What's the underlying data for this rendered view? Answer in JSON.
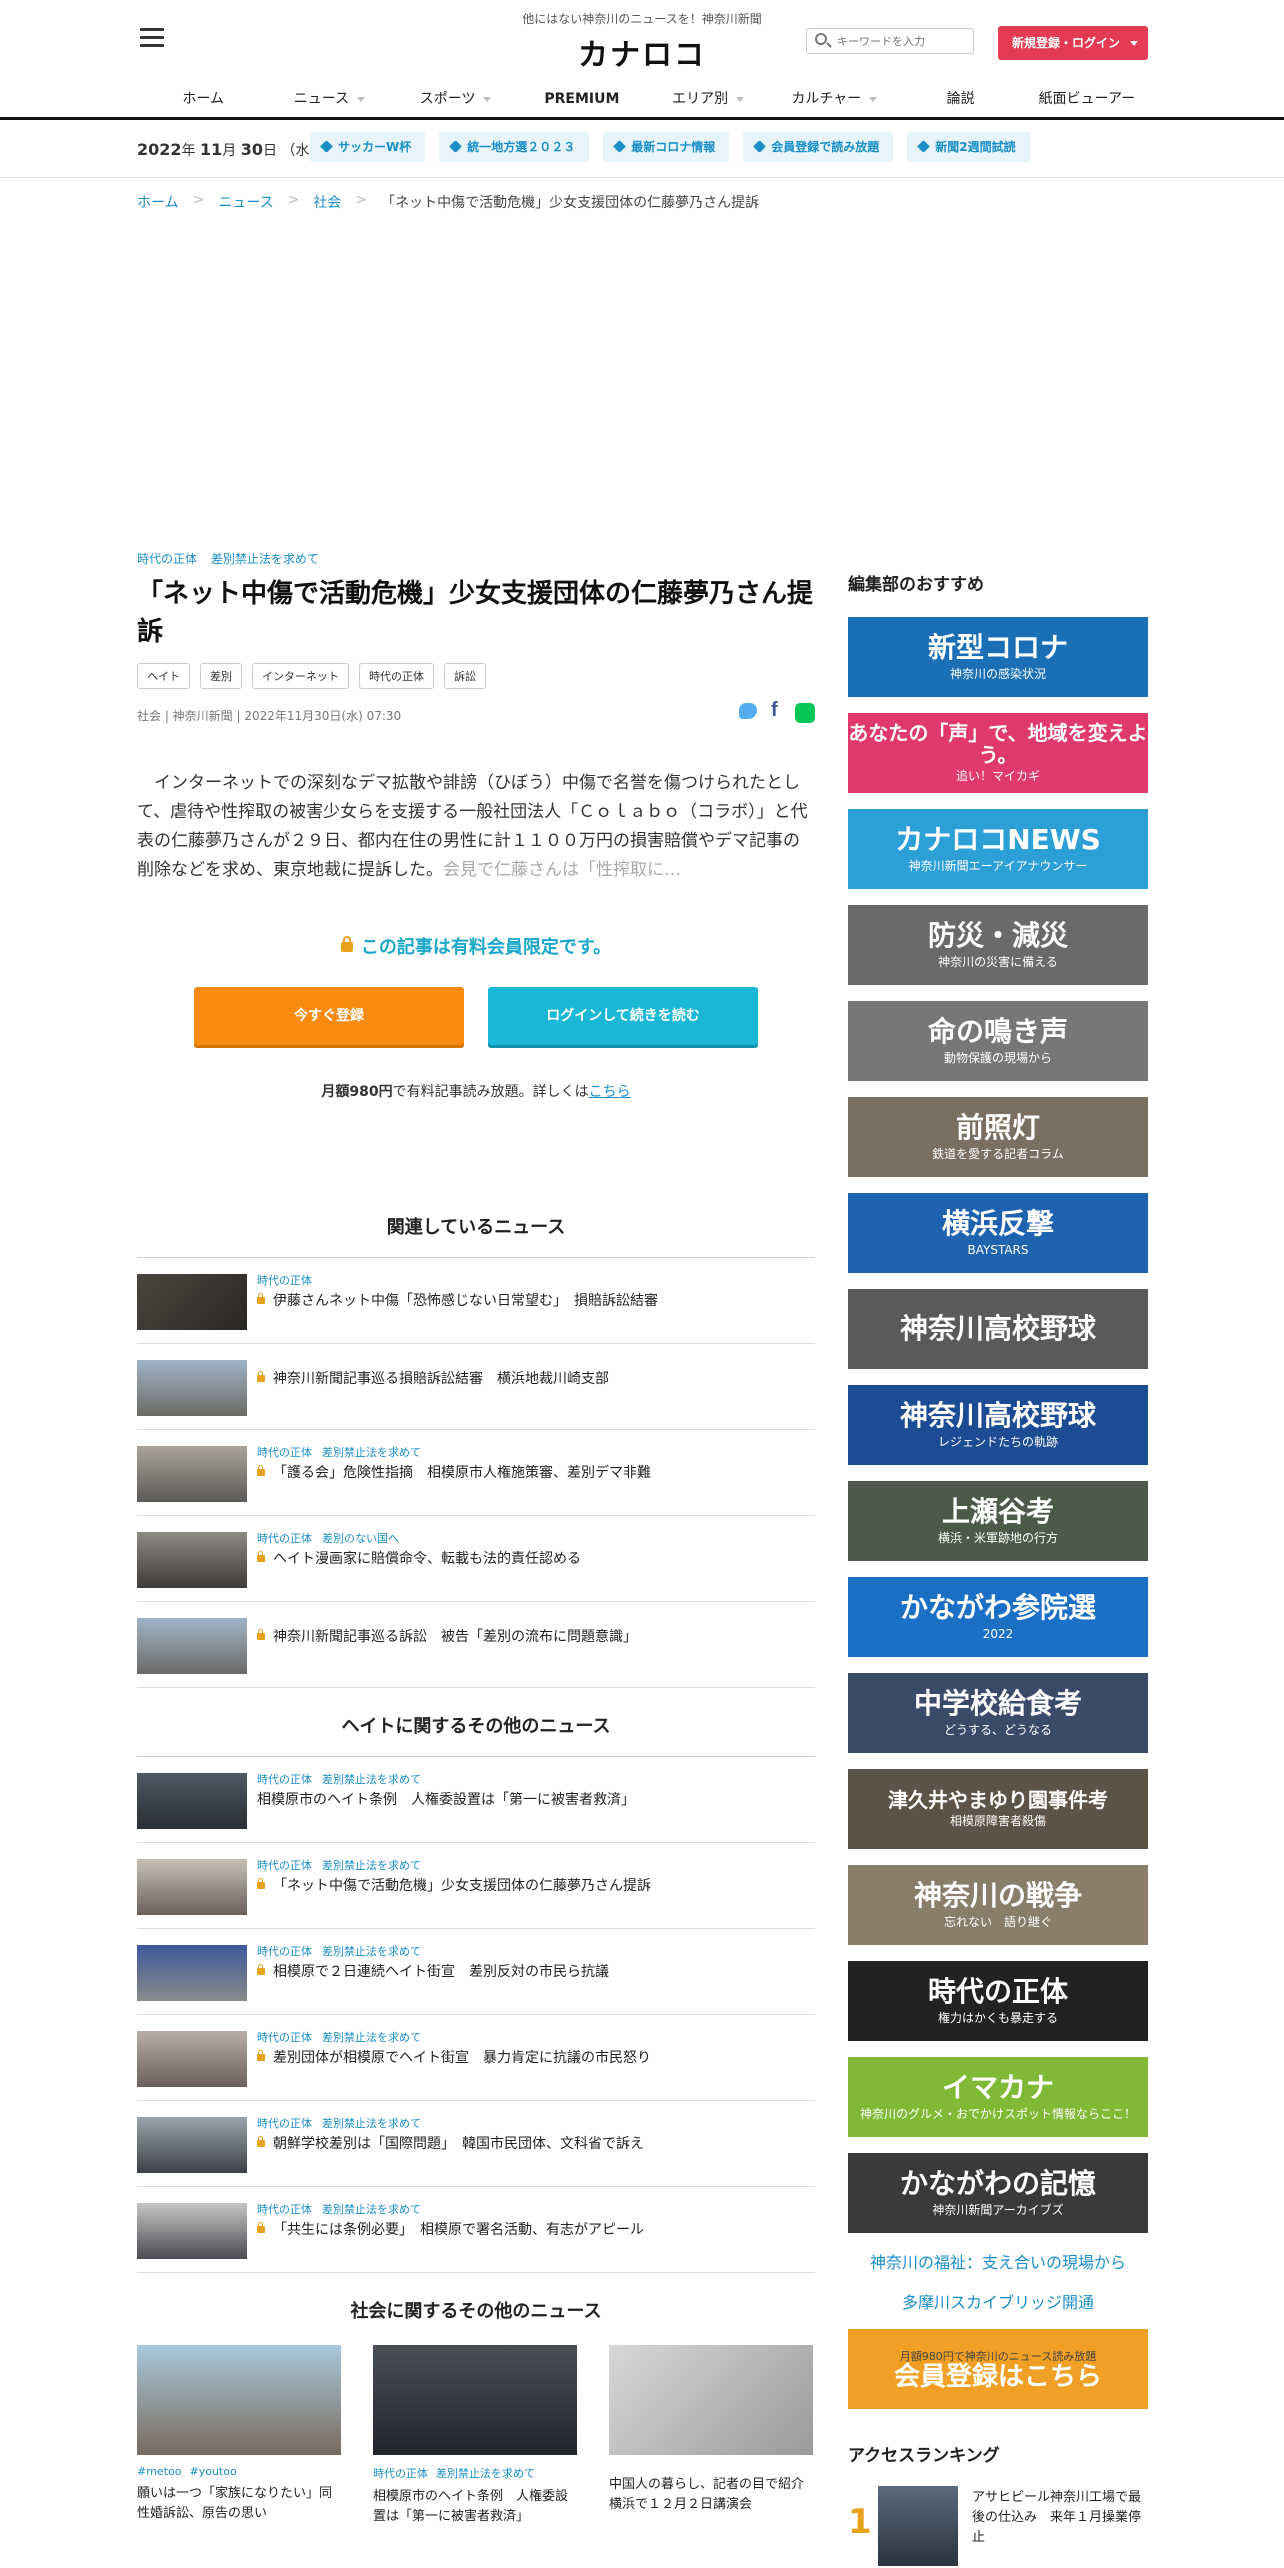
{
  "header": {
    "tagline": "他にはない神奈川のニュースを！神奈川新聞",
    "logo": "カナロコ",
    "search_placeholder": "キーワードを入力",
    "login_label": "新規登録・ログイン",
    "nav": [
      "ホーム",
      "ニュース",
      "スポーツ",
      "PREMIUM",
      "エリア別",
      "カルチャー",
      "論説",
      "紙面ビューアー"
    ]
  },
  "topbar": {
    "year": "2022",
    "year_suffix": "年",
    "month": "11",
    "month_suffix": "月",
    "day": "30",
    "day_suffix": "日",
    "weekday": "（水）",
    "chips": [
      "サッカーW杯",
      "統一地方選２０２３",
      "最新コロナ情報",
      "会員登録で読み放題",
      "新聞2週間試読"
    ]
  },
  "breadcrumb": [
    "ホーム",
    "ニュース",
    "社会",
    "「ネット中傷で活動危機」少女支援団体の仁藤夢乃さん提訴"
  ],
  "article": {
    "categories": [
      "時代の正体",
      "差別禁止法を求めて"
    ],
    "title": "「ネット中傷で活動危機」少女支援団体の仁藤夢乃さん提訴",
    "keywords": [
      "ヘイト",
      "差別",
      "インターネット",
      "時代の正体",
      "訴訟"
    ],
    "meta": "社会 | 神奈川新聞 | 2022年11月30日(水) 07:30",
    "lead": "インターネットでの深刻なデマ拡散や誹謗（ひぼう）中傷で名誉を傷つけられたとして、虐待や性搾取の被害少女らを支援する一般社団法人「Ｃｏｌａｂｏ（コラボ）」と代表の仁藤夢乃さんが２９日、都内在住の男性に計１１００万円の損害賠償やデマ記事の削除などを求め、東京地裁に提訴した。",
    "lead_fade": "会見で仁藤さんは「性搾取に…",
    "paywall_text": "この記事は有料会員限定です。",
    "register_label": "今すぐ登録",
    "login_continue_label": "ログインして続きを読む",
    "price_bold": "月額980円",
    "price_rest": "で有料記事読み放題。詳しくは",
    "price_link": "こちら"
  },
  "related": {
    "title": "関連しているニュース",
    "items": [
      {
        "tags": [
          "時代の正体"
        ],
        "text": "伊藤さんネット中傷「恐怖感じない日常望む」　損賠訴訟結審"
      },
      {
        "tags": [],
        "text": "神奈川新聞記事巡る損賠訴訟結審　横浜地裁川崎支部"
      },
      {
        "tags": [
          "時代の正体",
          "差別禁止法を求めて"
        ],
        "text": "「護る会」危険性指摘　相模原市人権施策審、差別デマ非難"
      },
      {
        "tags": [
          "時代の正体",
          "差別のない国へ"
        ],
        "text": "ヘイト漫画家に賠償命令、転載も法的責任認める"
      },
      {
        "tags": [],
        "text": "神奈川新聞記事巡る訴訟　被告「差別の流布に問題意識」"
      }
    ]
  },
  "hate_news": {
    "title": "ヘイトに関するその他のニュース",
    "items": [
      {
        "tags": [
          "時代の正体",
          "差別禁止法を求めて"
        ],
        "lock": false,
        "text": "相模原市のヘイト条例　人権委設置は「第一に被害者救済」"
      },
      {
        "tags": [
          "時代の正体",
          "差別禁止法を求めて"
        ],
        "lock": true,
        "text": "「ネット中傷で活動危機」少女支援団体の仁藤夢乃さん提訴"
      },
      {
        "tags": [
          "時代の正体",
          "差別禁止法を求めて"
        ],
        "lock": true,
        "text": "相模原で２日連続ヘイト街宣　差別反対の市民ら抗議"
      },
      {
        "tags": [
          "時代の正体",
          "差別禁止法を求めて"
        ],
        "lock": true,
        "text": "差別団体が相模原でヘイト街宣　暴力肯定に抗議の市民怒り"
      },
      {
        "tags": [
          "時代の正体",
          "差別禁止法を求めて"
        ],
        "lock": true,
        "text": "朝鮮学校差別は「国際問題」　韓国市民団体、文科省で訴え"
      },
      {
        "tags": [
          "時代の正体",
          "差別禁止法を求めて"
        ],
        "lock": true,
        "text": "「共生には条例必要」　相模原で署名活動、有志がアピール"
      }
    ]
  },
  "society_news": {
    "title": "社会に関するその他のニュース",
    "cards": [
      {
        "tags": [
          "#metoo",
          "#youtoo"
        ],
        "text": "願いは一つ「家族になりたい」同性婚訴訟、原告の思い"
      },
      {
        "tags": [
          "時代の正体",
          "差別禁止法を求めて"
        ],
        "text": "相模原市のヘイト条例　人権委設置は「第一に被害者救済」"
      },
      {
        "tags": [],
        "text": "中国人の暮らし、記者の目で紹介　横浜で１２月２日講演会"
      }
    ]
  },
  "sidebar": {
    "title": "編集部のおすすめ",
    "banners": [
      {
        "main": "新型コロナ",
        "sub": "神奈川の感染状況",
        "color": "#1a6fb5"
      },
      {
        "main": "あなたの「声」で、地域を変えよう。",
        "sub": "追い！マイカギ",
        "color": "#e03a6c"
      },
      {
        "main": "カナロコNEWS",
        "sub": "神奈川新聞エーアイアナウンサー",
        "color": "#2c9fd6"
      },
      {
        "main": "防災・減災",
        "sub": "神奈川の災害に備える",
        "color": "#6a6a6a"
      },
      {
        "main": "命の鳴き声",
        "sub": "動物保護の現場から",
        "color": "#777"
      },
      {
        "main": "前照灯",
        "sub": "鉄道を愛する記者コラム",
        "color": "#7a6f60"
      },
      {
        "main": "横浜反撃",
        "sub": "BAYSTARS",
        "color": "#1e63b0"
      },
      {
        "main": "神奈川高校野球",
        "sub": "",
        "color": "#5a5a5a"
      },
      {
        "main": "神奈川高校野球",
        "sub": "レジェンドたちの軌跡",
        "color": "#1c4c94"
      },
      {
        "main": "上瀬谷考",
        "sub": "横浜・米軍跡地の行方",
        "color": "#4d5a4a"
      },
      {
        "main": "かながわ参院選",
        "sub": "2022",
        "color": "#1b6fc4"
      },
      {
        "main": "中学校給食考",
        "sub": "どうする、どうなる",
        "color": "#3a4b6a"
      },
      {
        "main": "津久井やまゆり園事件考",
        "sub": "相模原障害者殺傷",
        "color": "#5e5347"
      },
      {
        "main": "神奈川の戦争",
        "sub": "忘れない　語り継ぐ",
        "color": "#8a7d6a"
      },
      {
        "main": "時代の正体",
        "sub": "権力はかくも暴走する",
        "color": "#222"
      },
      {
        "main": "イマカナ",
        "sub": "神奈川のグルメ・おでかけスポット情報ならここ！",
        "color": "#7fb935"
      },
      {
        "main": "かながわの記憶",
        "sub": "神奈川新聞アーカイブズ",
        "color": "#3a3a3a"
      }
    ],
    "links": [
      "神奈川の福祉：支え合いの現場から",
      "多摩川スカイブリッジ開通"
    ],
    "member_banner": {
      "main": "会員登録はこちら",
      "sub": "月額980円で神奈川のニュース読み放題",
      "color": "#f0a024"
    },
    "ranking_title": "アクセスランキング",
    "ranking": [
      {
        "num": "1",
        "text": "アサヒビール神奈川工場で最後の仕込み　来年１月操業停止"
      }
    ]
  }
}
